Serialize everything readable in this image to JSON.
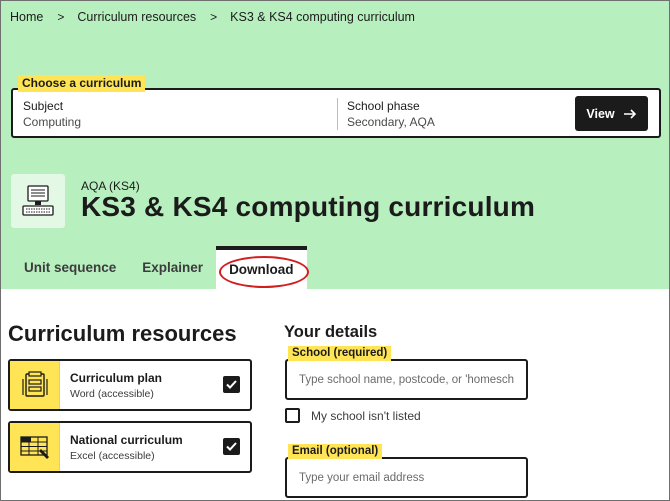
{
  "breadcrumb": {
    "items": [
      "Home",
      "Curriculum resources",
      "KS3 & KS4 computing curriculum"
    ],
    "separator": ">"
  },
  "chooser": {
    "label": "Choose a curriculum",
    "subject_label": "Subject",
    "subject_value": "Computing",
    "phase_label": "School phase",
    "phase_value": "Secondary, AQA",
    "view_label": "View",
    "view_icon": "arrow-right-icon"
  },
  "header": {
    "icon": "computer-icon",
    "eyebrow": "AQA (KS4)",
    "title": "KS3 & KS4 computing curriculum"
  },
  "tabs": [
    {
      "label": "Unit sequence",
      "active": false
    },
    {
      "label": "Explainer",
      "active": false
    },
    {
      "label": "Download",
      "active": true
    }
  ],
  "resources": {
    "heading": "Curriculum resources",
    "items": [
      {
        "name": "Curriculum plan",
        "type": "Word (accessible)",
        "icon": "document-stack-icon",
        "checked": true
      },
      {
        "name": "National curriculum",
        "type": "Excel (accessible)",
        "icon": "spreadsheet-icon",
        "checked": true
      }
    ]
  },
  "details": {
    "heading": "Your details",
    "school_label": "School (required)",
    "school_placeholder": "Type school name, postcode, or 'homeschool'",
    "unlisted_label": "My school isn't listed",
    "unlisted_checked": false,
    "email_label": "Email (optional)",
    "email_placeholder": "Type your email address"
  },
  "colors": {
    "hero_bg": "#b8efbf",
    "highlight": "#ffe555",
    "dark": "#1b1b1b",
    "annotation": "#d11f1f"
  }
}
